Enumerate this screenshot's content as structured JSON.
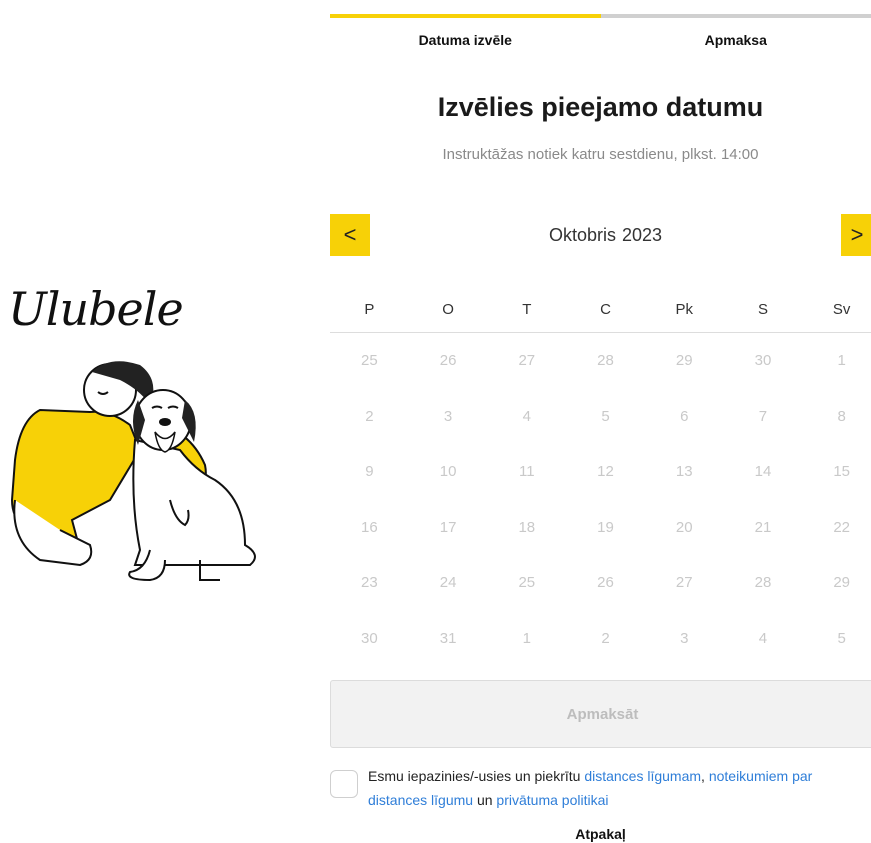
{
  "brand": {
    "logo_text": "Ulubele"
  },
  "steps": [
    {
      "label": "Datuma izvēle",
      "active": true
    },
    {
      "label": "Apmaksa",
      "active": false
    }
  ],
  "heading": "Izvēlies pieejamo datumu",
  "subheading": "Instruktāžas notiek katru sestdienu, plkst. 14:00",
  "calendar": {
    "prev_label": "<",
    "next_label": ">",
    "month": "Oktobris",
    "year": "2023",
    "weekdays": [
      "P",
      "O",
      "T",
      "C",
      "Pk",
      "S",
      "Sv"
    ],
    "weeks": [
      [
        "25",
        "26",
        "27",
        "28",
        "29",
        "30",
        "1"
      ],
      [
        "2",
        "3",
        "4",
        "5",
        "6",
        "7",
        "8"
      ],
      [
        "9",
        "10",
        "11",
        "12",
        "13",
        "14",
        "15"
      ],
      [
        "16",
        "17",
        "18",
        "19",
        "20",
        "21",
        "22"
      ],
      [
        "23",
        "24",
        "25",
        "26",
        "27",
        "28",
        "29"
      ],
      [
        "30",
        "31",
        "1",
        "2",
        "3",
        "4",
        "5"
      ]
    ]
  },
  "pay_button": "Apmaksāt",
  "consent": {
    "prefix": "Esmu iepazinies/-usies un piekrītu ",
    "link1": "distances līgumam",
    "sep1": ", ",
    "link2": "noteikumiem par distances līgumu",
    "sep2": " un ",
    "link3": "privātuma politikai"
  },
  "back": "Atpakaļ",
  "colors": {
    "accent": "#f7d107",
    "link": "#2f7ed8",
    "muted": "#c9c9c9"
  }
}
